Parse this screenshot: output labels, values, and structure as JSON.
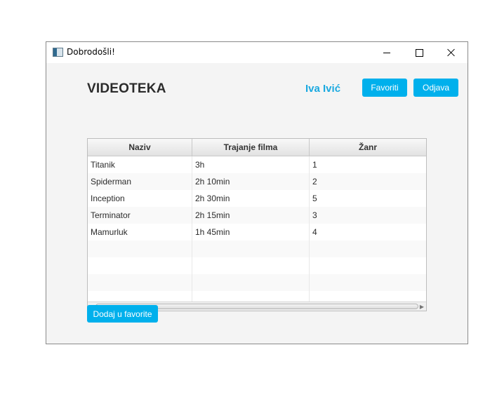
{
  "window": {
    "title": "Dobrodošli!",
    "controls": [
      "minimize",
      "maximize",
      "close"
    ]
  },
  "header": {
    "title": "VIDEOTEKA",
    "user_name": "Iva Ivić",
    "favorites_label": "Favoriti",
    "logout_label": "Odjava"
  },
  "table": {
    "columns": [
      "Naziv",
      "Trajanje filma",
      "Žanr"
    ],
    "rows": [
      {
        "naziv": "Titanik",
        "trajanje": "3h",
        "zanr": "1"
      },
      {
        "naziv": "Spiderman",
        "trajanje": "2h 10min",
        "zanr": "2"
      },
      {
        "naziv": "Inception",
        "trajanje": "2h 30min",
        "zanr": "5"
      },
      {
        "naziv": "Terminator",
        "trajanje": "2h 15min",
        "zanr": "3"
      },
      {
        "naziv": "Mamurluk",
        "trajanje": "1h 45min",
        "zanr": "4"
      },
      {
        "naziv": "",
        "trajanje": "",
        "zanr": ""
      },
      {
        "naziv": "",
        "trajanje": "",
        "zanr": ""
      },
      {
        "naziv": "",
        "trajanje": "",
        "zanr": ""
      },
      {
        "naziv": "",
        "trajanje": "",
        "zanr": ""
      }
    ]
  },
  "footer": {
    "add_favorite_label": "Dodaj u favorite"
  },
  "colors": {
    "accent": "#00b0ec",
    "username": "#1aa9e0",
    "background": "#f4f4f4"
  }
}
